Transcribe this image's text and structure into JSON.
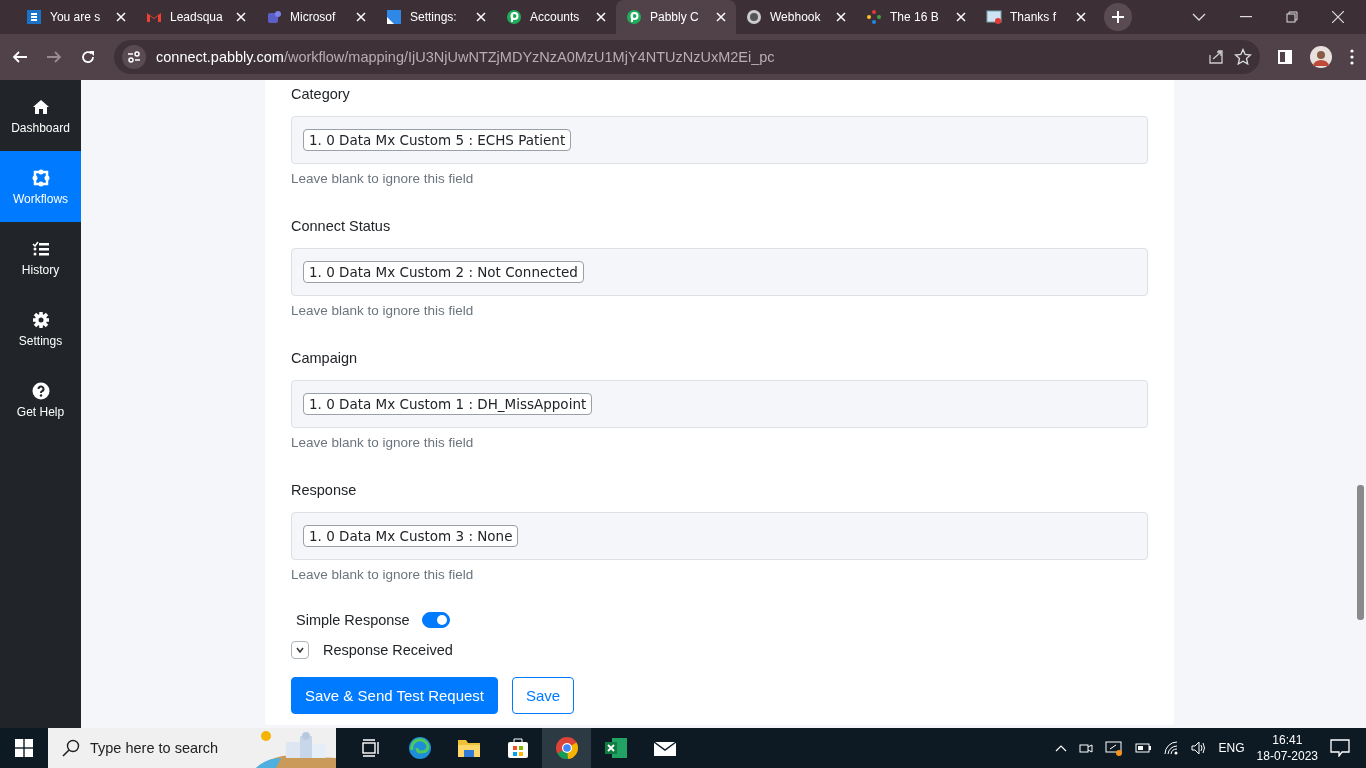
{
  "browser": {
    "tabs": [
      {
        "title": "You are s",
        "selected": false
      },
      {
        "title": "Leadsqua",
        "selected": false
      },
      {
        "title": "Microsof",
        "selected": false
      },
      {
        "title": "Settings:",
        "selected": false
      },
      {
        "title": "Accounts",
        "selected": false
      },
      {
        "title": "Pabbly C",
        "selected": true
      },
      {
        "title": "Webhook",
        "selected": false
      },
      {
        "title": "The 16 B",
        "selected": false
      },
      {
        "title": "Thanks f",
        "selected": false
      }
    ],
    "address": {
      "domain": "connect.pabbly.com",
      "path": "/workflow/mapping/IjU3NjUwNTZjMDYzNzA0MzU1MjY4NTUzNzUxM2Ei_pc"
    }
  },
  "sidebar": {
    "items": [
      {
        "label": "Dashboard",
        "selected": false
      },
      {
        "label": "Workflows",
        "selected": true
      },
      {
        "label": "History",
        "selected": false
      },
      {
        "label": "Settings",
        "selected": false
      },
      {
        "label": "Get Help",
        "selected": false
      }
    ]
  },
  "form": {
    "fields": [
      {
        "label": "Category",
        "value": "1. 0 Data Mx Custom 5 : ECHS Patient",
        "hint": "Leave blank to ignore this field"
      },
      {
        "label": "Connect Status",
        "value": "1. 0 Data Mx Custom 2 : Not Connected",
        "hint": "Leave blank to ignore this field"
      },
      {
        "label": "Campaign",
        "value": "1. 0 Data Mx Custom 1 : DH_MissAppoint",
        "hint": "Leave blank to ignore this field"
      },
      {
        "label": "Response",
        "value": "1. 0 Data Mx Custom 3 : None",
        "hint": "Leave blank to ignore this field"
      }
    ],
    "toggle": {
      "label": "Simple Response",
      "on": true
    },
    "collapsible": {
      "label": "Response Received",
      "expanded": false
    },
    "buttons": [
      {
        "label": "Save & Send Test Request",
        "kind": "primary"
      },
      {
        "label": "Save",
        "kind": "outline"
      }
    ]
  },
  "taskbar": {
    "search": {
      "placeholder": "Type here to search"
    },
    "language": "ENG",
    "time": "16:41",
    "date": "18-07-2023"
  }
}
